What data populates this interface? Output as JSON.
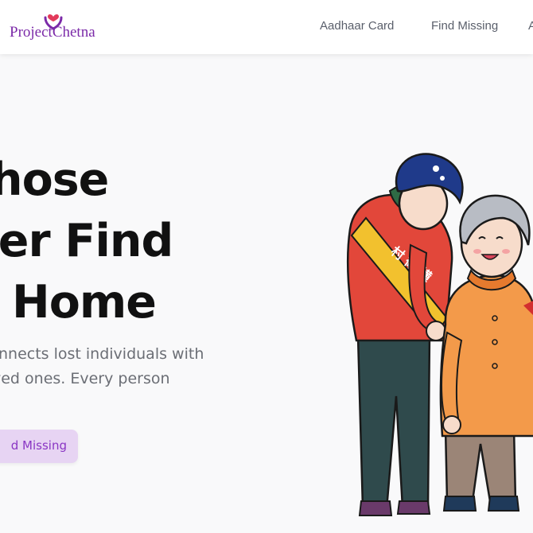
{
  "header": {
    "brand": "ProjectChetna",
    "nav": [
      {
        "label": "Aadhaar Card"
      },
      {
        "label": "Find Missing"
      },
      {
        "label": "A"
      }
    ]
  },
  "hero": {
    "headline": [
      "hose",
      "der Find",
      "y Home"
    ],
    "description": [
      "nnects lost individuals with",
      "ved ones. Every person"
    ],
    "cta_label": "d Missing"
  },
  "illustration": {
    "sash_text": "村 衛 横"
  },
  "colors": {
    "brand": "#7b2aa8",
    "cta_background": "#e7d4f3",
    "cta_text": "#8a36c4",
    "heading": "#111111",
    "body_text": "#6b6e75"
  }
}
